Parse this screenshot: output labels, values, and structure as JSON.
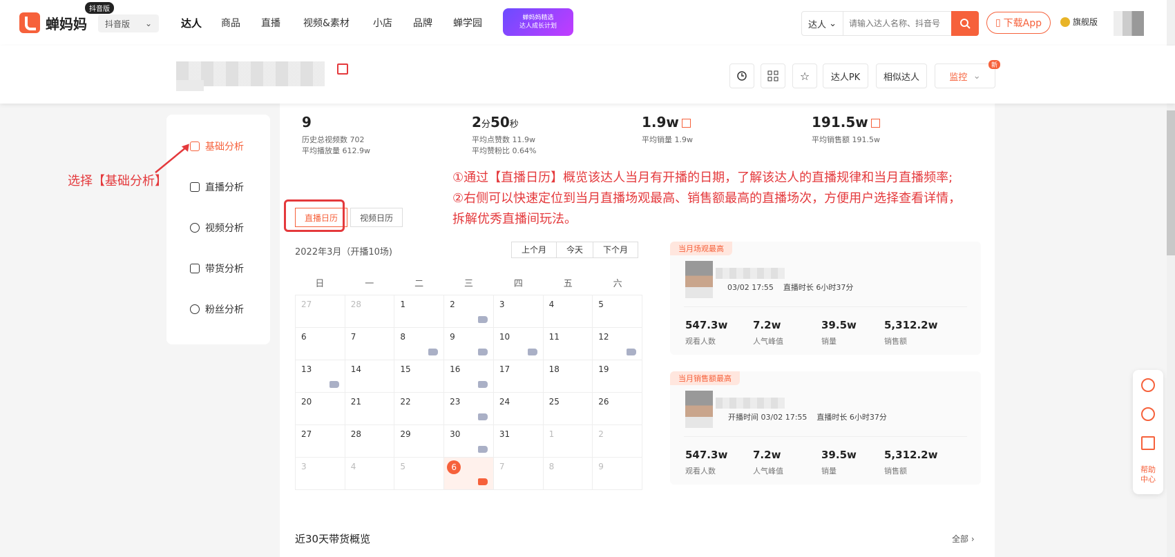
{
  "nav": {
    "logo_text": "蝉妈妈",
    "douyin_badge": "抖音版",
    "version_select": "抖音版",
    "items": [
      {
        "label": "达人"
      },
      {
        "label": "商品"
      },
      {
        "label": "直播"
      },
      {
        "label": "视频&素材"
      },
      {
        "label": "小店"
      },
      {
        "label": "品牌"
      },
      {
        "label": "蝉学园"
      }
    ],
    "promo_line1": "蝉妈妈精选",
    "promo_line2": "达人成长计划",
    "search_type": "达人",
    "search_placeholder": "请输入达人名称、抖音号",
    "download_label": "下载App",
    "flagship_label": "旗舰版",
    "accent": "#f6613b"
  },
  "header": {
    "tools": [
      "达人PK",
      "相似达人"
    ],
    "monitor_label": "监控",
    "new_badge": "新"
  },
  "stats": [
    {
      "value": "9",
      "sub1": "历史总视频数 702",
      "sub2": "平均播放量   612.9w"
    },
    {
      "value_main": "2",
      "value_unit1": "分",
      "value_main2": "50",
      "value_unit2": "秒",
      "sub1": "平均点赞数 11.9w",
      "sub2": "平均赞粉比 0.64%"
    },
    {
      "value": "1.9w",
      "sub1": "平均销量 1.9w"
    },
    {
      "value": "191.5w",
      "sub1": "平均销售额 191.5w"
    }
  ],
  "menu": [
    {
      "label": "基础分析",
      "active": true
    },
    {
      "label": "直播分析"
    },
    {
      "label": "视频分析"
    },
    {
      "label": "带货分析"
    },
    {
      "label": "粉丝分析"
    }
  ],
  "annotations": {
    "left": "选择【基础分析】",
    "right_1": "①通过【直播日历】概览该达人当月有开播的日期，了解该达人的直播规律和当月直播频率;",
    "right_2": "②右侧可以快速定位到当月直播场观最高、销售额最高的直播场次，方便用户选择查看详情，",
    "right_3": "拆解优秀直播间玩法。"
  },
  "tabs": {
    "live": "直播日历",
    "video": "视频日历"
  },
  "calendar": {
    "title": "2022年3月（开播10场)",
    "nav": [
      "上个月",
      "今天",
      "下个月"
    ],
    "weekdays": [
      "日",
      "一",
      "二",
      "三",
      "四",
      "五",
      "六"
    ]
  },
  "best_views": {
    "tag": "当月场观最高",
    "time": "03/02 17:55",
    "duration": "直播时长 6小时37分",
    "stats": [
      {
        "value": "547.3w",
        "label": "观看人数"
      },
      {
        "value": "7.2w",
        "label": "人气峰值"
      },
      {
        "value": "39.5w",
        "label": "销量"
      },
      {
        "value": "5,312.2w",
        "label": "销售额"
      }
    ]
  },
  "best_sales": {
    "tag": "当月销售额最高",
    "time": "开播时间 03/02 17:55",
    "duration": "直播时长 6小时37分",
    "stats": [
      {
        "value": "547.3w",
        "label": "观看人数"
      },
      {
        "value": "7.2w",
        "label": "人气峰值"
      },
      {
        "value": "39.5w",
        "label": "销量"
      },
      {
        "value": "5,312.2w",
        "label": "销售额"
      }
    ]
  },
  "section": {
    "title": "近30天带货概览",
    "see_all": "全部"
  },
  "float": {
    "help": "帮助中心"
  }
}
